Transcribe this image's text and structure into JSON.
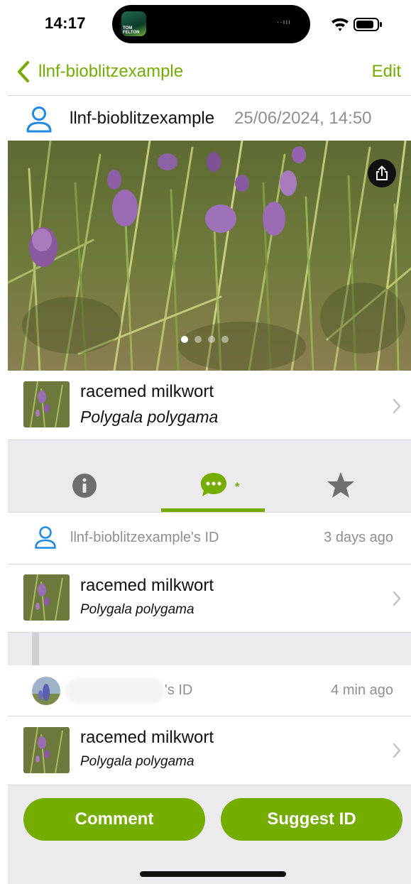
{
  "status_bar": {
    "time": "14:17",
    "island_art_text": "TOM FELTON"
  },
  "nav": {
    "back_label": "llnf-bioblitzexample",
    "edit_label": "Edit"
  },
  "observation": {
    "username": "llnf-bioblitzexample",
    "date": "25/06/2024, 14:50",
    "photo_count": 4,
    "current_photo": 1
  },
  "taxon": {
    "common_name": "racemed milkwort",
    "scientific_name": "Polygala polygama"
  },
  "tabs": {
    "items": [
      {
        "name": "info",
        "icon": "info-icon"
      },
      {
        "name": "activity",
        "icon": "chat-bubble-icon",
        "badge": "*"
      },
      {
        "name": "faves",
        "icon": "star-icon"
      }
    ],
    "active": "activity"
  },
  "activity": {
    "items": [
      {
        "id_label": "llnf-bioblitzexample's ID",
        "time": "3 days ago",
        "common_name": "racemed milkwort",
        "scientific_name": "Polygala polygama"
      },
      {
        "id_label": "'s ID",
        "time": "4 min ago",
        "common_name": "racemed milkwort",
        "scientific_name": "Polygala polygama"
      }
    ]
  },
  "actions": {
    "comment_label": "Comment",
    "suggest_label": "Suggest ID"
  },
  "colors": {
    "accent": "#74ac00",
    "user_icon": "#1e88e5",
    "band": "#ebebed",
    "muted_text": "#8e8e93"
  }
}
